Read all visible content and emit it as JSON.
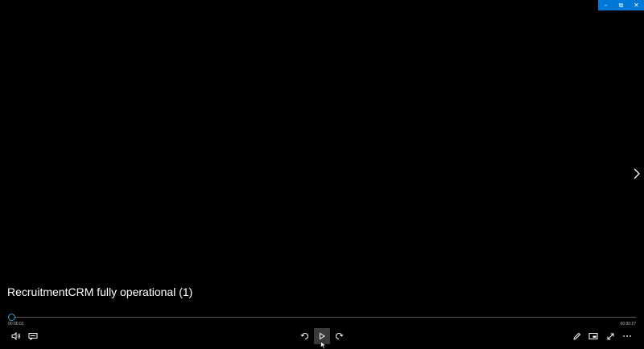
{
  "window": {
    "minimize_label": "–",
    "restore_label": "⧉",
    "close_label": "✕",
    "accent_color": "#0078d7"
  },
  "player": {
    "title": "RecruitmentCRM fully operational (1)",
    "time_current": "00:00:01",
    "time_total": "00:00:27",
    "progress": 0.01,
    "seek_color": "#3a9bdc"
  },
  "controls": {
    "left": [
      "volume-icon",
      "captions-icon"
    ],
    "center": [
      "skip-back-10-icon",
      "play-icon",
      "skip-forward-30-icon"
    ],
    "right": [
      "edit-icon",
      "mini-view-icon",
      "fullscreen-icon",
      "more-icon"
    ]
  },
  "navigation": {
    "next_icon": "chevron-right-icon"
  }
}
